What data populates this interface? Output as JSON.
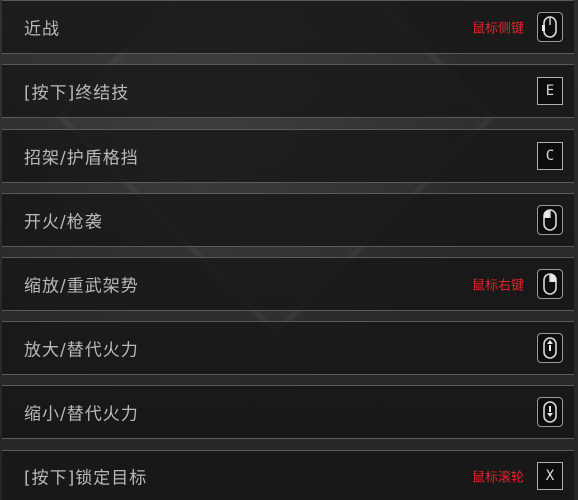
{
  "bindings": [
    {
      "label": "近战",
      "hint": "鼠标侧键",
      "input": {
        "type": "mouse",
        "icon": "mouse-side-button-icon"
      }
    },
    {
      "label": "[按下]终结技",
      "hint": "",
      "input": {
        "type": "key",
        "key": "E"
      }
    },
    {
      "label": "招架/护盾格挡",
      "hint": "",
      "input": {
        "type": "key",
        "key": "C"
      }
    },
    {
      "label": "开火/枪袭",
      "hint": "",
      "input": {
        "type": "mouse",
        "icon": "mouse-left-button-icon"
      }
    },
    {
      "label": "缩放/重武架势",
      "hint": "鼠标右键",
      "input": {
        "type": "mouse",
        "icon": "mouse-right-button-icon"
      }
    },
    {
      "label": "放大/替代火力",
      "hint": "",
      "input": {
        "type": "mouse",
        "icon": "mouse-scroll-up-icon"
      }
    },
    {
      "label": "缩小/替代火力",
      "hint": "",
      "input": {
        "type": "mouse",
        "icon": "mouse-scroll-down-icon"
      }
    },
    {
      "label": "[按下]锁定目标",
      "hint": "鼠标滚轮",
      "input": {
        "type": "key",
        "key": "X"
      }
    }
  ],
  "colors": {
    "hint": "#e0262b",
    "label": "#b9b9b9",
    "row_bg": "#141414",
    "row_border": "#5a5a5a"
  }
}
